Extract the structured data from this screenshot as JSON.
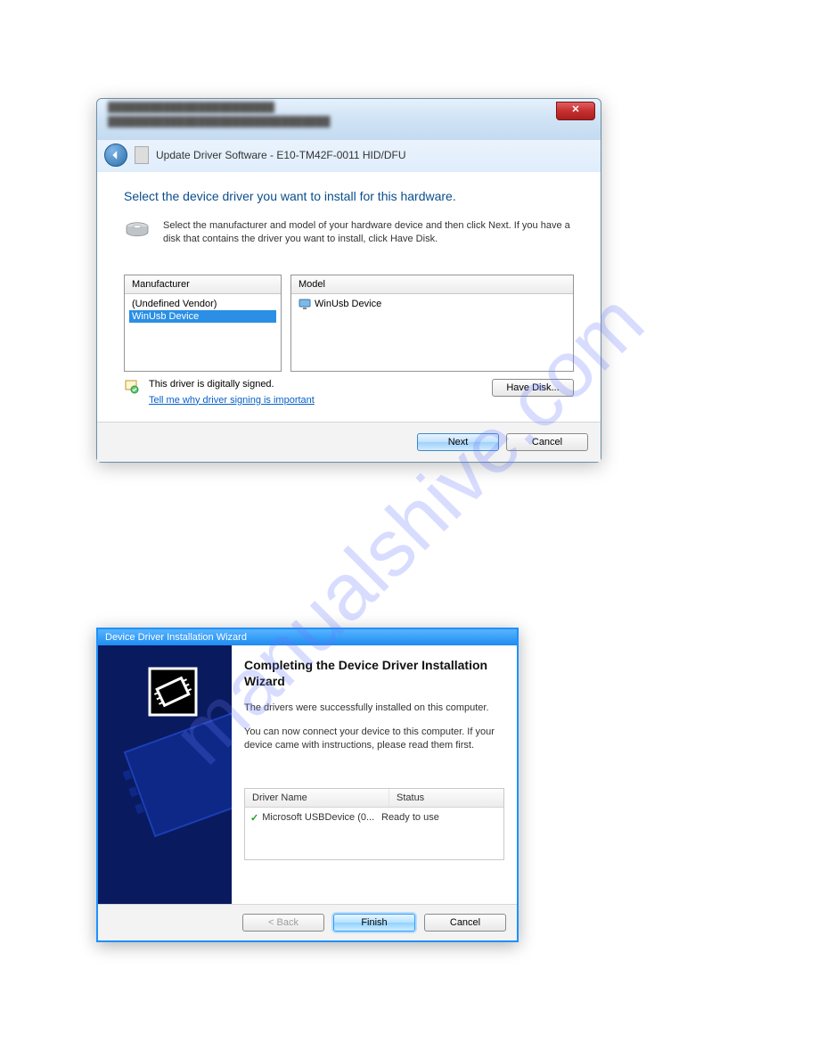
{
  "watermark": "manualshive.com",
  "window1": {
    "close_label": "✕",
    "blurred_row1": "████████████████████████",
    "blurred_row2": "████████████████████████████████",
    "nav_title": "Update Driver Software - E10-TM42F-0011 HID/DFU",
    "heading": "Select the device driver you want to install for this hardware.",
    "instructions": "Select the manufacturer and model of your hardware device and then click Next. If you have a disk that contains the driver you want to install, click Have Disk.",
    "manufacturer_header": "Manufacturer",
    "manufacturers": {
      "undefined": "(Undefined Vendor)",
      "winusb": "WinUsb Device"
    },
    "model_header": "Model",
    "model_value": "WinUsb Device",
    "signed_text": "This driver is digitally signed.",
    "signed_link": "Tell me why driver signing is important",
    "have_disk_label": "Have Disk...",
    "next_label": "Next",
    "cancel_label": "Cancel"
  },
  "window2": {
    "title": "Device Driver Installation Wizard",
    "heading": "Completing the Device Driver Installation Wizard",
    "success_text": "The drivers were successfully installed on this computer.",
    "connect_text": "You can now connect your device to this computer. If your device came with instructions, please read them first.",
    "col_driver": "Driver Name",
    "col_status": "Status",
    "row_driver": "Microsoft USBDevice  (0...",
    "row_status": "Ready to use",
    "back_label": "< Back",
    "finish_label": "Finish",
    "cancel_label": "Cancel"
  }
}
